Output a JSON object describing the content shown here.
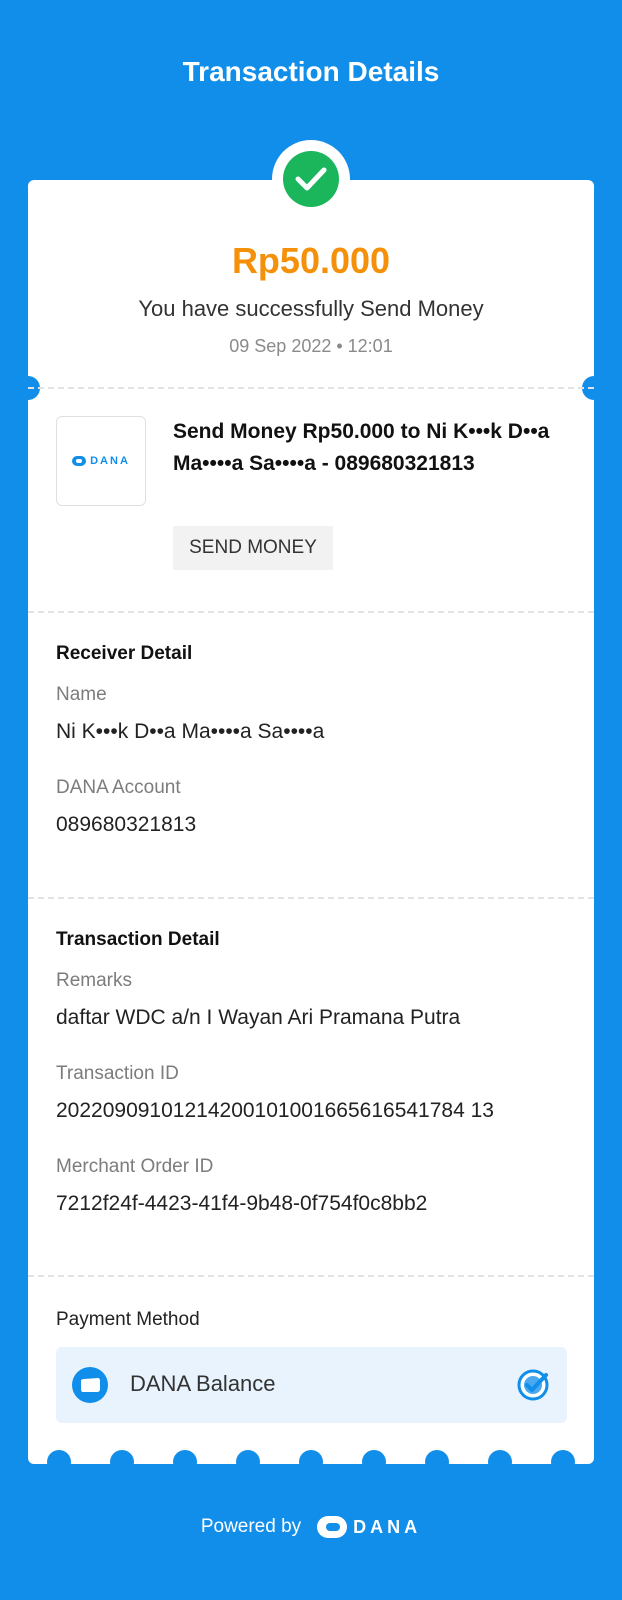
{
  "header": {
    "title": "Transaction Details"
  },
  "summary": {
    "amount": "Rp50.000",
    "message": "You have successfully Send Money",
    "datetime": "09 Sep 2022 • 12:01"
  },
  "transaction": {
    "logo_text": "DANA",
    "title": "Send Money Rp50.000 to Ni K•••k D••a Ma••••a Sa••••a - 089680321813",
    "badge": "SEND MONEY"
  },
  "receiver": {
    "section_title": "Receiver Detail",
    "name_label": "Name",
    "name_value": "Ni K•••k D••a Ma••••a Sa••••a",
    "account_label": "DANA Account",
    "account_value": "089680321813"
  },
  "detail": {
    "section_title": "Transaction Detail",
    "remarks_label": "Remarks",
    "remarks_value": "daftar WDC a/n I Wayan Ari Pramana Putra",
    "txid_label": "Transaction ID",
    "txid_value": "20220909101214200101001665616541784 13",
    "order_label": "Merchant Order ID",
    "order_value": "7212f24f-4423-41f4-9b48-0f754f0c8bb2"
  },
  "payment": {
    "title": "Payment Method",
    "method": "DANA Balance"
  },
  "footer": {
    "powered_by": "Powered by",
    "brand": "DANA"
  },
  "colors": {
    "brand_blue": "#108ee9",
    "amount_orange": "#f5900b",
    "success_green": "#1bb55c"
  },
  "icons": {
    "status": "check-icon",
    "payment": "wallet-icon",
    "selected": "verified-check-icon"
  }
}
